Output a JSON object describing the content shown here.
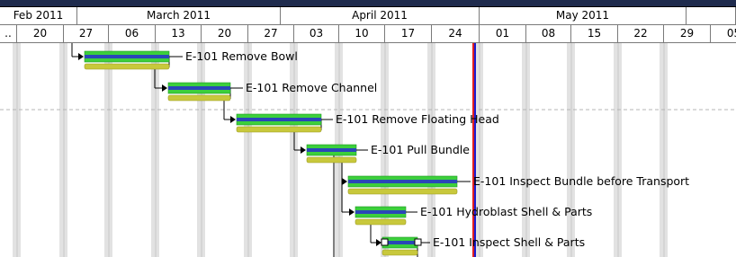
{
  "timescale": {
    "months": [
      {
        "label": "Feb 2011"
      },
      {
        "label": "March 2011"
      },
      {
        "label": "April 2011"
      },
      {
        "label": "May 2011"
      },
      {
        "label": ""
      }
    ],
    "weeks": [
      "..",
      "20",
      "27",
      "06",
      "13",
      "20",
      "27",
      "03",
      "10",
      "17",
      "24",
      "01",
      "08",
      "15",
      "22",
      "29",
      "05"
    ]
  },
  "colors": {
    "header_band": "#1f2b4d",
    "grid_line": "#d8d8d8",
    "bar_outer": "#2a46b8",
    "bar_inner": "#3ccf3c",
    "baseline": "#c8c83c",
    "status_line": "#1a1ad0",
    "status_line_edge": "#e02020",
    "link": "#000000"
  },
  "tasks": [
    {
      "name": "E-101 Remove Bowl"
    },
    {
      "name": "E-101 Remove Channel"
    },
    {
      "name": "E-101 Remove Floating Head"
    },
    {
      "name": "E-101 Pull Bundle"
    },
    {
      "name": "E-101 Inspect Bundle before Transport"
    },
    {
      "name": "E-101 Hydroblast Shell & Parts"
    },
    {
      "name": "E-101 Inspect Shell & Parts"
    }
  ]
}
